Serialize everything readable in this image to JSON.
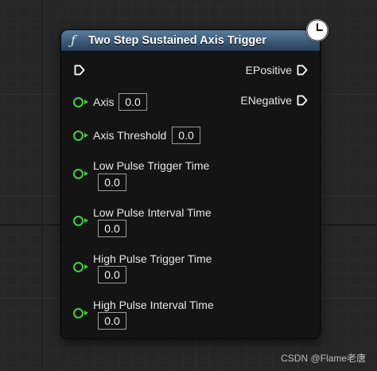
{
  "node": {
    "title": "Two Step Sustained Axis Trigger",
    "function_icon": "ƒ",
    "latent_icon": "clock-icon"
  },
  "outputs": [
    {
      "label": "EPositive"
    },
    {
      "label": "ENegative"
    }
  ],
  "inputs": [
    {
      "label": "Axis",
      "value": "0.0"
    },
    {
      "label": "Axis Threshold",
      "value": "0.0"
    },
    {
      "label": "Low Pulse Trigger Time",
      "value": "0.0"
    },
    {
      "label": "Low Pulse Interval Time",
      "value": "0.0"
    },
    {
      "label": "High Pulse Trigger Time",
      "value": "0.0"
    },
    {
      "label": "High Pulse Interval Time",
      "value": "0.0"
    }
  ],
  "colors": {
    "header": "#3b5a77",
    "float_pin": "#3fd03f",
    "node_body": "#141414"
  },
  "watermark": "CSDN @Flame老唐"
}
